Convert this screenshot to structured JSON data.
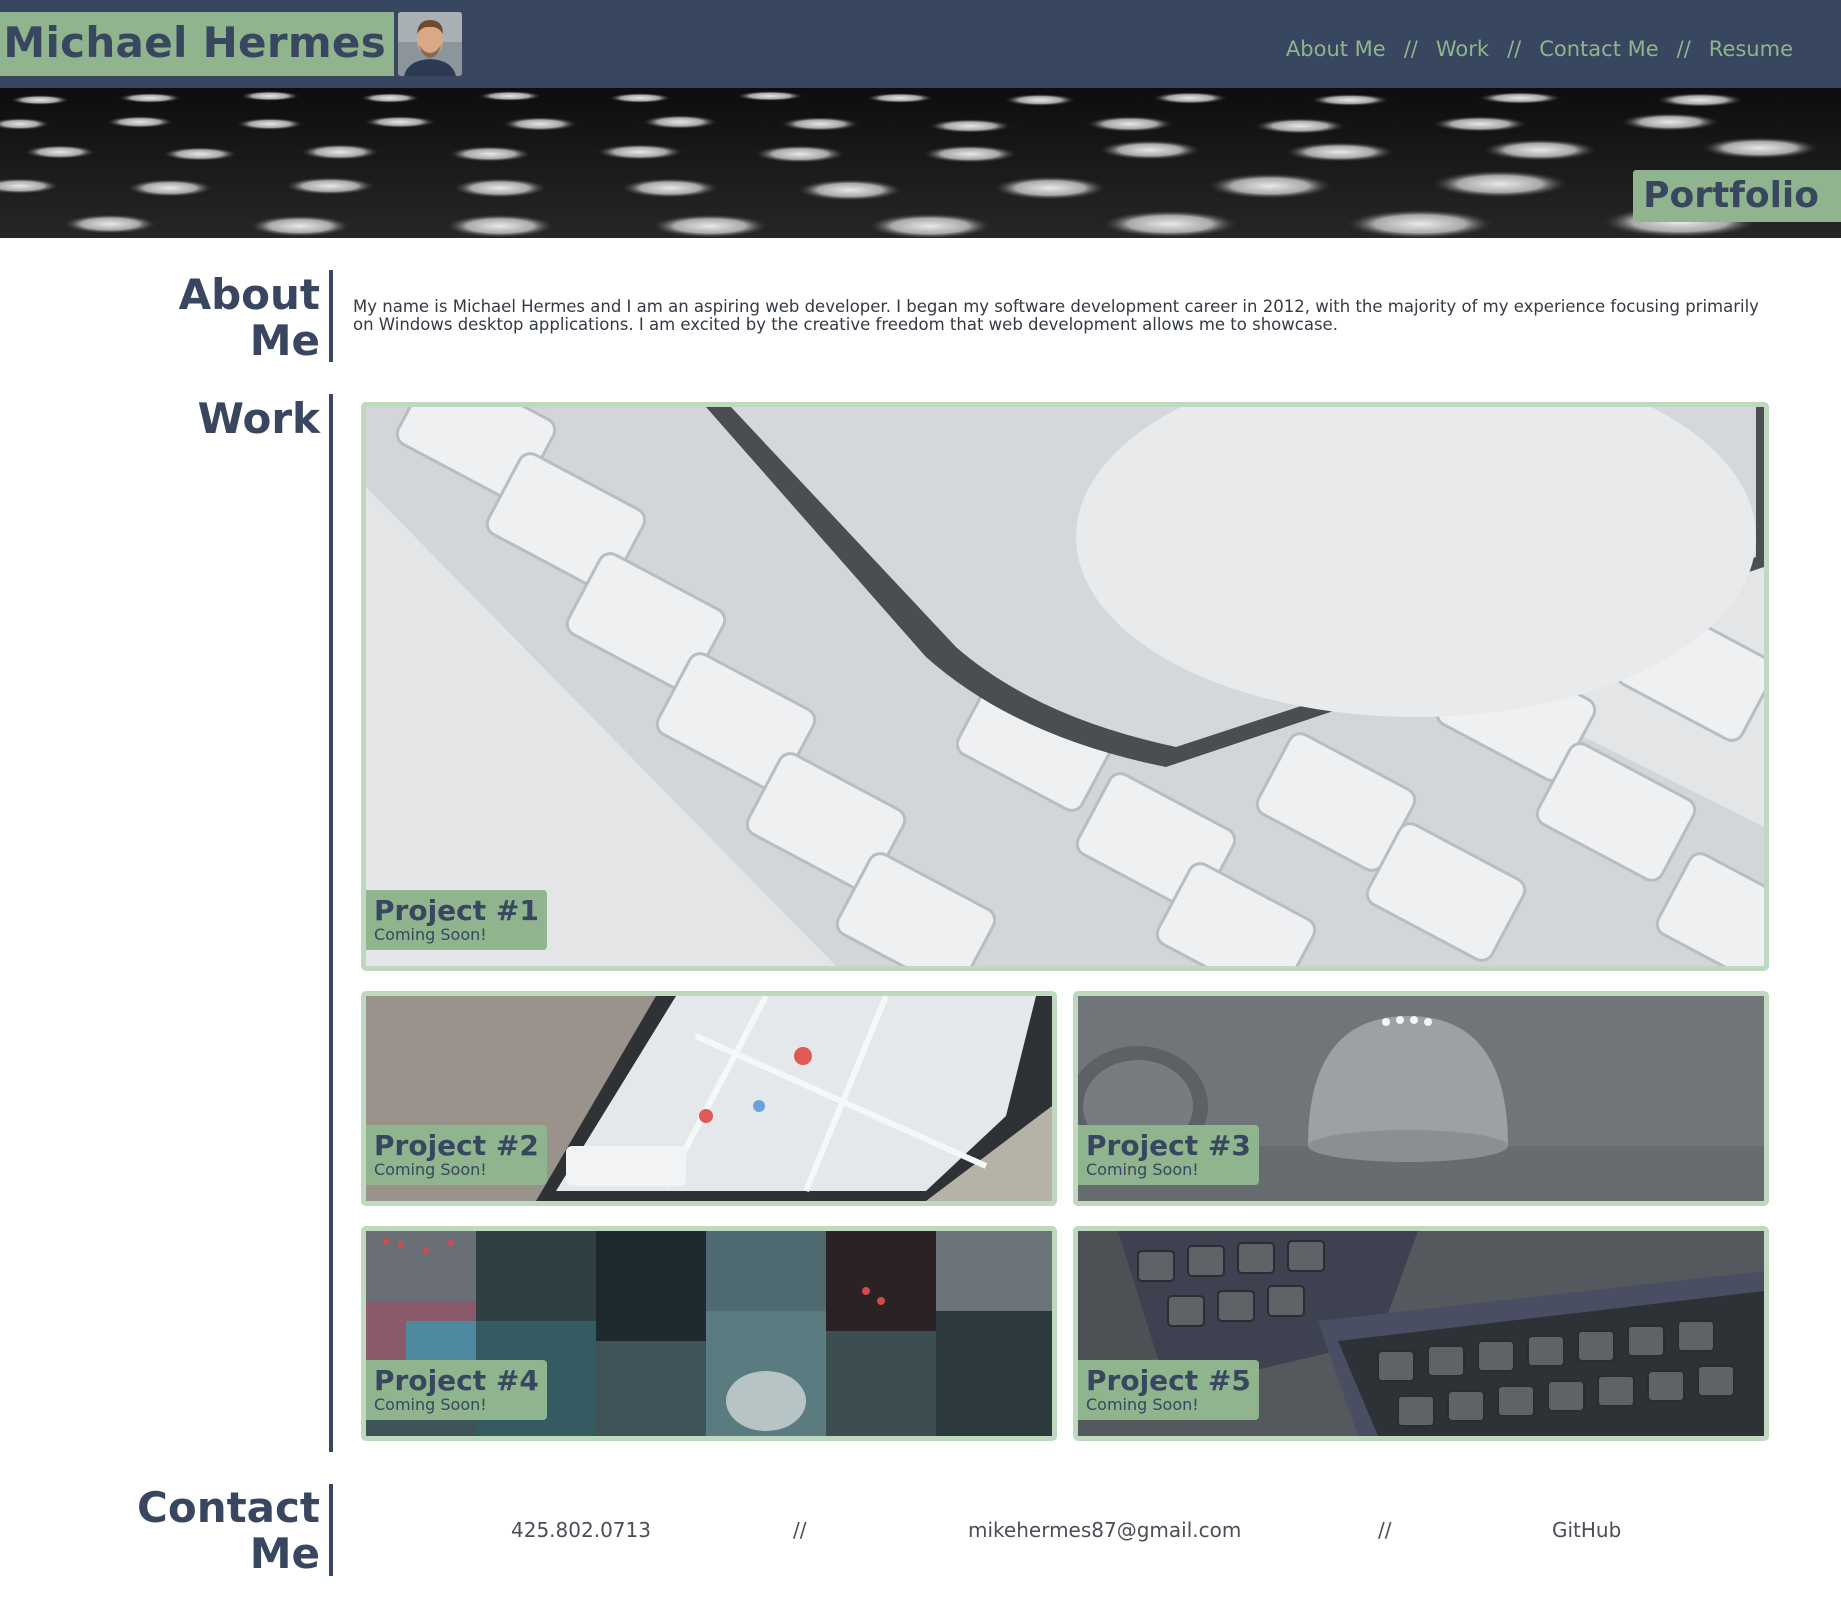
{
  "header": {
    "name": "Michael Hermes",
    "nav": [
      "About Me",
      "Work",
      "Contact Me",
      "Resume"
    ],
    "separator": "//"
  },
  "hero": {
    "badge": "Portfolio"
  },
  "about": {
    "heading_line1": "About",
    "heading_line2": "Me",
    "text": "My name is Michael Hermes and I am an aspiring web developer. I began my software development career in 2012, with the majority of my experience focusing primarily on Windows desktop applications. I am excited by the creative freedom that web development allows me to showcase."
  },
  "work": {
    "heading": "Work",
    "projects": [
      {
        "title": "Project #1",
        "subtitle": "Coming Soon!",
        "image": "keyboard-phone-photo"
      },
      {
        "title": "Project #2",
        "subtitle": "Coming Soon!",
        "image": "phone-map-photo"
      },
      {
        "title": "Project #3",
        "subtitle": "Coming Soon!",
        "image": "smart-speaker-photo"
      },
      {
        "title": "Project #4",
        "subtitle": "Coming Soon!",
        "image": "city-collage-photo"
      },
      {
        "title": "Project #5",
        "subtitle": "Coming Soon!",
        "image": "split-keyboard-photo"
      }
    ]
  },
  "contact": {
    "heading_line1": "Contact",
    "heading_line2": "Me",
    "phone": "425.802.0713",
    "email": "mikehermes87@gmail.com",
    "github": "GitHub",
    "separator": "//"
  },
  "colors": {
    "navy": "#38465f",
    "green": "#8fb48e",
    "card_border": "#bed9bd"
  }
}
